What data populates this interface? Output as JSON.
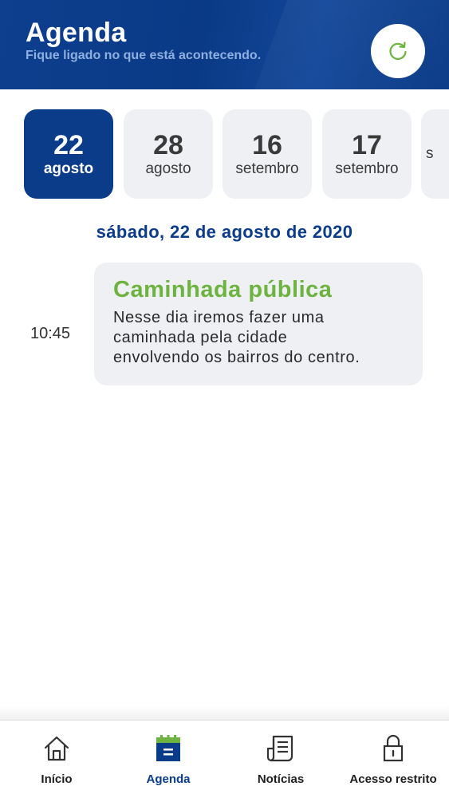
{
  "header": {
    "title": "Agenda",
    "subtitle": "Fique ligado no que está acontecendo.",
    "refresh_icon": "refresh-icon"
  },
  "date_strip": {
    "dates": [
      {
        "day": "22",
        "month": "agosto",
        "active": true
      },
      {
        "day": "28",
        "month": "agosto",
        "active": false
      },
      {
        "day": "16",
        "month": "setembro",
        "active": false
      },
      {
        "day": "17",
        "month": "setembro",
        "active": false
      },
      {
        "day": "",
        "month": "s",
        "active": false
      }
    ]
  },
  "selected_date": "sábado, 22 de agosto de 2020",
  "events": [
    {
      "time": "10:45",
      "title": "Caminhada pública",
      "description_lines": [
        "Nesse dia iremos fazer uma",
        "caminhada pela cidade",
        "envolvendo os bairros do centro."
      ]
    }
  ],
  "bottom_nav": {
    "items": [
      {
        "label": "Início",
        "icon": "home-icon",
        "active": false
      },
      {
        "label": "Agenda",
        "icon": "calendar-icon",
        "active": true
      },
      {
        "label": "Notícias",
        "icon": "news-icon",
        "active": false
      },
      {
        "label": "Acesso restrito",
        "icon": "lock-icon",
        "active": false
      }
    ]
  },
  "colors": {
    "brand_blue": "#0b3c8a",
    "accent_green": "#6cb33f",
    "card_gray": "#eef0f3"
  }
}
